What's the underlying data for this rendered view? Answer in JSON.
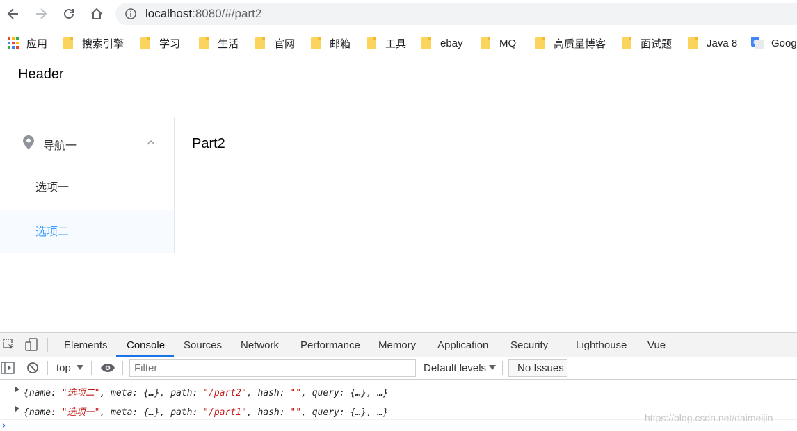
{
  "browser": {
    "url_host": "localhost",
    "url_rest": ":8080/#/part2",
    "bookmarks": [
      "应用",
      "搜索引擎",
      "学习",
      "生活",
      "官网",
      "邮箱",
      "工具",
      "ebay",
      "MQ",
      "高质量博客",
      "面试题",
      "Java 8",
      "Goog"
    ]
  },
  "page": {
    "header": "Header",
    "menu": {
      "submenu_title": "导航一",
      "items": [
        "选项一",
        "选项二"
      ],
      "active_item": "选项二"
    },
    "content": "Part2"
  },
  "devtools": {
    "tabs": [
      "Elements",
      "Console",
      "Sources",
      "Network",
      "Performance",
      "Memory",
      "Application",
      "Security",
      "Lighthouse",
      "Vue"
    ],
    "active_tab": "Console",
    "context": "top",
    "filter_placeholder": "Filter",
    "levels": "Default levels",
    "issues": "No Issues",
    "logs": [
      {
        "pre": "{name: ",
        "name": "\"选项二\"",
        "mid": ", meta: {…}, path: ",
        "path": "\"/part2\"",
        "mid2": ", hash: ",
        "hash": "\"\"",
        "post": ", query: {…}, …}"
      },
      {
        "pre": "{name: ",
        "name": "\"选项一\"",
        "mid": ", meta: {…}, path: ",
        "path": "\"/part1\"",
        "mid2": ", hash: ",
        "hash": "\"\"",
        "post": ", query: {…}, …}"
      }
    ],
    "prompt": "›"
  },
  "watermark": "https://blog.csdn.net/daimeijin",
  "colors": {
    "accent": "#409eff",
    "devtools_active": "#1a73e8"
  }
}
